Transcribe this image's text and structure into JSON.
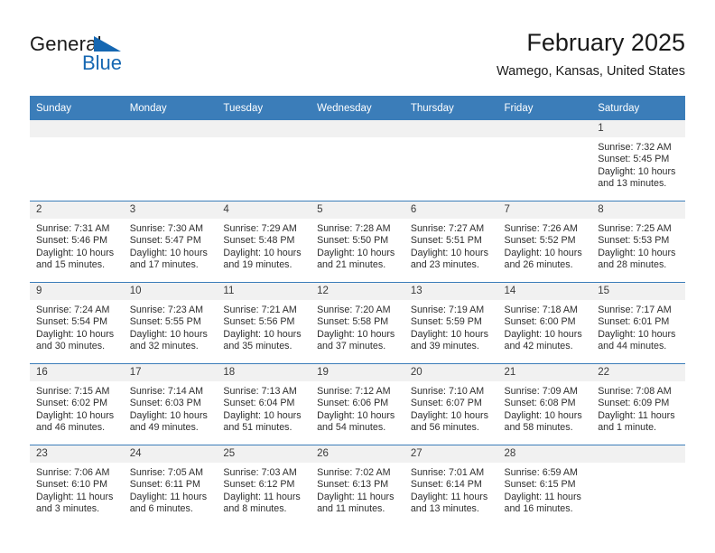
{
  "brand": {
    "name_part1": "General",
    "name_part2": "Blue",
    "triangle_color": "#1567b2",
    "text_color": "#1a1a1a"
  },
  "header": {
    "title": "February 2025",
    "subtitle": "Wamego, Kansas, United States"
  },
  "colors": {
    "header_bar": "#3b7db9",
    "daynum_band": "#f1f1f1",
    "grid_line": "#3b7db9",
    "text": "#2e2e2e"
  },
  "weekday_headers": [
    "Sunday",
    "Monday",
    "Tuesday",
    "Wednesday",
    "Thursday",
    "Friday",
    "Saturday"
  ],
  "weeks": [
    [
      {
        "day": "",
        "sunrise": "",
        "sunset": "",
        "daylight": ""
      },
      {
        "day": "",
        "sunrise": "",
        "sunset": "",
        "daylight": ""
      },
      {
        "day": "",
        "sunrise": "",
        "sunset": "",
        "daylight": ""
      },
      {
        "day": "",
        "sunrise": "",
        "sunset": "",
        "daylight": ""
      },
      {
        "day": "",
        "sunrise": "",
        "sunset": "",
        "daylight": ""
      },
      {
        "day": "",
        "sunrise": "",
        "sunset": "",
        "daylight": ""
      },
      {
        "day": "1",
        "sunrise": "Sunrise: 7:32 AM",
        "sunset": "Sunset: 5:45 PM",
        "daylight": "Daylight: 10 hours and 13 minutes."
      }
    ],
    [
      {
        "day": "2",
        "sunrise": "Sunrise: 7:31 AM",
        "sunset": "Sunset: 5:46 PM",
        "daylight": "Daylight: 10 hours and 15 minutes."
      },
      {
        "day": "3",
        "sunrise": "Sunrise: 7:30 AM",
        "sunset": "Sunset: 5:47 PM",
        "daylight": "Daylight: 10 hours and 17 minutes."
      },
      {
        "day": "4",
        "sunrise": "Sunrise: 7:29 AM",
        "sunset": "Sunset: 5:48 PM",
        "daylight": "Daylight: 10 hours and 19 minutes."
      },
      {
        "day": "5",
        "sunrise": "Sunrise: 7:28 AM",
        "sunset": "Sunset: 5:50 PM",
        "daylight": "Daylight: 10 hours and 21 minutes."
      },
      {
        "day": "6",
        "sunrise": "Sunrise: 7:27 AM",
        "sunset": "Sunset: 5:51 PM",
        "daylight": "Daylight: 10 hours and 23 minutes."
      },
      {
        "day": "7",
        "sunrise": "Sunrise: 7:26 AM",
        "sunset": "Sunset: 5:52 PM",
        "daylight": "Daylight: 10 hours and 26 minutes."
      },
      {
        "day": "8",
        "sunrise": "Sunrise: 7:25 AM",
        "sunset": "Sunset: 5:53 PM",
        "daylight": "Daylight: 10 hours and 28 minutes."
      }
    ],
    [
      {
        "day": "9",
        "sunrise": "Sunrise: 7:24 AM",
        "sunset": "Sunset: 5:54 PM",
        "daylight": "Daylight: 10 hours and 30 minutes."
      },
      {
        "day": "10",
        "sunrise": "Sunrise: 7:23 AM",
        "sunset": "Sunset: 5:55 PM",
        "daylight": "Daylight: 10 hours and 32 minutes."
      },
      {
        "day": "11",
        "sunrise": "Sunrise: 7:21 AM",
        "sunset": "Sunset: 5:56 PM",
        "daylight": "Daylight: 10 hours and 35 minutes."
      },
      {
        "day": "12",
        "sunrise": "Sunrise: 7:20 AM",
        "sunset": "Sunset: 5:58 PM",
        "daylight": "Daylight: 10 hours and 37 minutes."
      },
      {
        "day": "13",
        "sunrise": "Sunrise: 7:19 AM",
        "sunset": "Sunset: 5:59 PM",
        "daylight": "Daylight: 10 hours and 39 minutes."
      },
      {
        "day": "14",
        "sunrise": "Sunrise: 7:18 AM",
        "sunset": "Sunset: 6:00 PM",
        "daylight": "Daylight: 10 hours and 42 minutes."
      },
      {
        "day": "15",
        "sunrise": "Sunrise: 7:17 AM",
        "sunset": "Sunset: 6:01 PM",
        "daylight": "Daylight: 10 hours and 44 minutes."
      }
    ],
    [
      {
        "day": "16",
        "sunrise": "Sunrise: 7:15 AM",
        "sunset": "Sunset: 6:02 PM",
        "daylight": "Daylight: 10 hours and 46 minutes."
      },
      {
        "day": "17",
        "sunrise": "Sunrise: 7:14 AM",
        "sunset": "Sunset: 6:03 PM",
        "daylight": "Daylight: 10 hours and 49 minutes."
      },
      {
        "day": "18",
        "sunrise": "Sunrise: 7:13 AM",
        "sunset": "Sunset: 6:04 PM",
        "daylight": "Daylight: 10 hours and 51 minutes."
      },
      {
        "day": "19",
        "sunrise": "Sunrise: 7:12 AM",
        "sunset": "Sunset: 6:06 PM",
        "daylight": "Daylight: 10 hours and 54 minutes."
      },
      {
        "day": "20",
        "sunrise": "Sunrise: 7:10 AM",
        "sunset": "Sunset: 6:07 PM",
        "daylight": "Daylight: 10 hours and 56 minutes."
      },
      {
        "day": "21",
        "sunrise": "Sunrise: 7:09 AM",
        "sunset": "Sunset: 6:08 PM",
        "daylight": "Daylight: 10 hours and 58 minutes."
      },
      {
        "day": "22",
        "sunrise": "Sunrise: 7:08 AM",
        "sunset": "Sunset: 6:09 PM",
        "daylight": "Daylight: 11 hours and 1 minute."
      }
    ],
    [
      {
        "day": "23",
        "sunrise": "Sunrise: 7:06 AM",
        "sunset": "Sunset: 6:10 PM",
        "daylight": "Daylight: 11 hours and 3 minutes."
      },
      {
        "day": "24",
        "sunrise": "Sunrise: 7:05 AM",
        "sunset": "Sunset: 6:11 PM",
        "daylight": "Daylight: 11 hours and 6 minutes."
      },
      {
        "day": "25",
        "sunrise": "Sunrise: 7:03 AM",
        "sunset": "Sunset: 6:12 PM",
        "daylight": "Daylight: 11 hours and 8 minutes."
      },
      {
        "day": "26",
        "sunrise": "Sunrise: 7:02 AM",
        "sunset": "Sunset: 6:13 PM",
        "daylight": "Daylight: 11 hours and 11 minutes."
      },
      {
        "day": "27",
        "sunrise": "Sunrise: 7:01 AM",
        "sunset": "Sunset: 6:14 PM",
        "daylight": "Daylight: 11 hours and 13 minutes."
      },
      {
        "day": "28",
        "sunrise": "Sunrise: 6:59 AM",
        "sunset": "Sunset: 6:15 PM",
        "daylight": "Daylight: 11 hours and 16 minutes."
      },
      {
        "day": "",
        "sunrise": "",
        "sunset": "",
        "daylight": ""
      }
    ]
  ]
}
